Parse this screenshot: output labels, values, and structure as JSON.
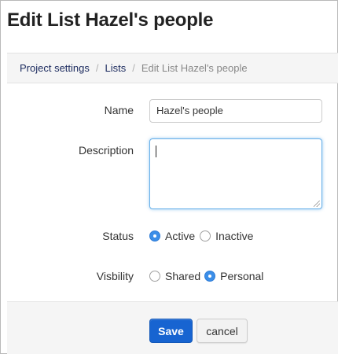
{
  "page": {
    "title": "Edit List Hazel's people"
  },
  "breadcrumb": {
    "items": [
      "Project settings",
      "Lists"
    ],
    "separator": "/",
    "current": "Edit List Hazel's people"
  },
  "form": {
    "name_label": "Name",
    "name_value": "Hazel's people",
    "description_label": "Description",
    "description_value": "",
    "status_label": "Status",
    "status_options": [
      "Active",
      "Inactive"
    ],
    "status_selected": "Active",
    "visibility_label": "Visbility",
    "visibility_options": [
      "Shared",
      "Personal"
    ],
    "visibility_selected": "Personal"
  },
  "buttons": {
    "save": "Save",
    "cancel": "cancel"
  },
  "colors": {
    "primary": "#1764d1",
    "radio_checked": "#3b8ee8",
    "focus": "#66afe9"
  }
}
